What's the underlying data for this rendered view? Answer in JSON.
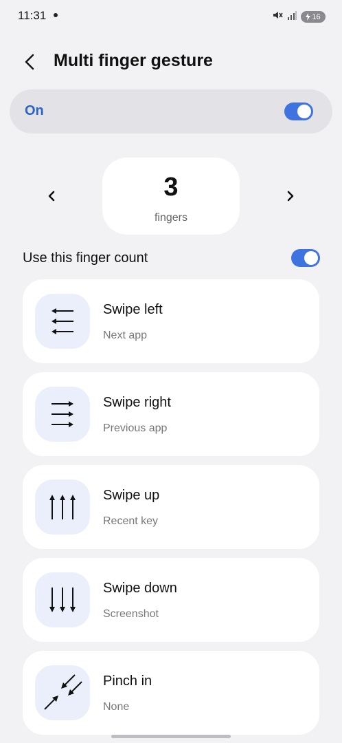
{
  "status": {
    "time": "11:31",
    "battery": "16",
    "icons": [
      "mute-icon",
      "signal-icon",
      "battery-charging-icon"
    ]
  },
  "header": {
    "title": "Multi finger gesture",
    "back_icon": "back-arrow-icon"
  },
  "master_switch": {
    "label": "On",
    "state": true
  },
  "finger_selector": {
    "count": "3",
    "unit": "fingers",
    "prev_icon": "chevron-left-icon",
    "next_icon": "chevron-right-icon"
  },
  "use_count": {
    "label": "Use this finger count",
    "state": true
  },
  "gestures": [
    {
      "title": "Swipe left",
      "action": "Next app",
      "icon": "arrows-left-icon"
    },
    {
      "title": "Swipe right",
      "action": "Previous app",
      "icon": "arrows-right-icon"
    },
    {
      "title": "Swipe up",
      "action": "Recent key",
      "icon": "arrows-up-icon"
    },
    {
      "title": "Swipe down",
      "action": "Screenshot",
      "icon": "arrows-down-icon"
    },
    {
      "title": "Pinch in",
      "action": "None",
      "icon": "pinch-in-icon"
    }
  ],
  "colors": {
    "accent": "#3f73e0",
    "accent_text": "#2a63c9",
    "background": "#f2f2f4",
    "card": "#ffffff",
    "icon_tile": "#eaeffb"
  }
}
